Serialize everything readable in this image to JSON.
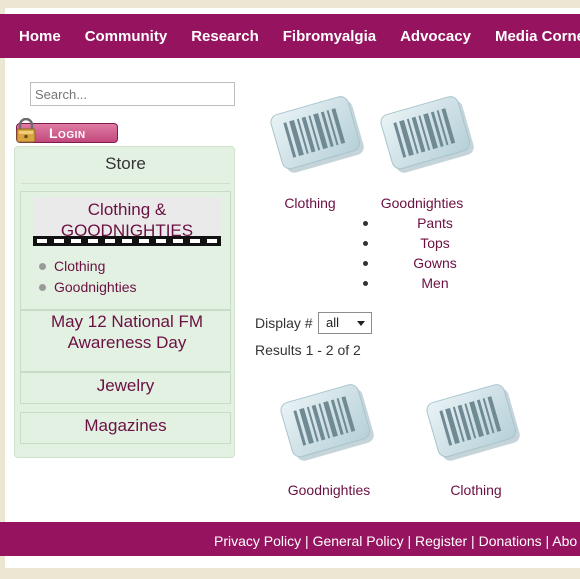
{
  "nav": {
    "items": [
      "Home",
      "Community",
      "Research",
      "Fibromyalgia",
      "Advocacy",
      "Media Corner"
    ]
  },
  "search": {
    "placeholder": "Search..."
  },
  "login": {
    "label": "Login"
  },
  "store": {
    "title": "Store",
    "categories": [
      {
        "label": "Clothing & GOODNIGHTIES",
        "subitems": [
          "Clothing",
          "Goodnighties"
        ]
      },
      {
        "label": "May 12 National FM Awareness Day"
      },
      {
        "label": "Jewelry"
      },
      {
        "label": "Magazines"
      }
    ]
  },
  "products_top": [
    {
      "label": "Clothing",
      "icon": "barcode-icon"
    },
    {
      "label": "Goodnighties",
      "icon": "barcode-icon",
      "subitems": [
        "Pants",
        "Tops",
        "Gowns",
        "Men"
      ]
    }
  ],
  "display": {
    "label": "Display #",
    "selected": "all"
  },
  "results": {
    "text": "Results 1 - 2 of 2"
  },
  "products_bottom": [
    {
      "label": "Goodnighties",
      "icon": "barcode-icon"
    },
    {
      "label": "Clothing",
      "icon": "barcode-icon"
    }
  ],
  "footer": {
    "links": [
      "Privacy Policy",
      "General Policy",
      "Register",
      "Donations",
      "Abo"
    ],
    "separator": " | "
  },
  "colors": {
    "brand": "#96135f",
    "link": "#6b1042",
    "store_bg": "#e3f1e3",
    "page_bg": "#ece7d3"
  }
}
